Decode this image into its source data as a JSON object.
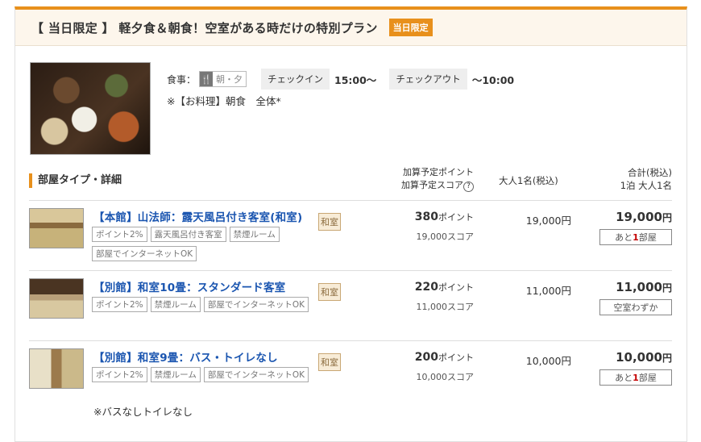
{
  "plan": {
    "title": "【 当日限定 】 軽夕食＆朝食！空室がある時だけの特別プラン",
    "badge": "当日限定",
    "meal_label": "食事：",
    "meal_value": "朝・夕",
    "checkin_label": "チェックイン",
    "checkin_time": "15:00〜",
    "checkout_label": "チェックアウト",
    "checkout_time": "〜10:00",
    "note": "※【お料理】朝食　全体*"
  },
  "table": {
    "room_type_header": "部屋タイプ・詳細",
    "points_header_1": "加算予定ポイント",
    "points_header_2": "加算予定スコア",
    "price_header": "大人1名(税込)",
    "total_header": "合計(税込)",
    "total_sub": "1泊 大人1名"
  },
  "rooms": [
    {
      "name": "【本館】山法師：露天風呂付き客室(和室)",
      "tags": [
        "ポイント2%",
        "露天風呂付き客室",
        "禁煙ルーム",
        "部屋でインターネットOK"
      ],
      "type": "和室",
      "points": "380",
      "points_unit": "ポイント",
      "score": "19,000スコア",
      "adult_price": "19,000円",
      "total": "19,000",
      "total_unit": "円",
      "avail_pre": "あと",
      "avail_num": "1",
      "avail_post": "部屋"
    },
    {
      "name": "【別館】和室10畳：スタンダード客室",
      "tags": [
        "ポイント2%",
        "禁煙ルーム",
        "部屋でインターネットOK"
      ],
      "type": "和室",
      "points": "220",
      "points_unit": "ポイント",
      "score": "11,000スコア",
      "adult_price": "11,000円",
      "total": "11,000",
      "total_unit": "円",
      "avail_text": "空室わずか"
    },
    {
      "name": "【別館】和室9畳：バス・トイレなし",
      "tags": [
        "ポイント2%",
        "禁煙ルーム",
        "部屋でインターネットOK"
      ],
      "type": "和室",
      "points": "200",
      "points_unit": "ポイント",
      "score": "10,000スコア",
      "adult_price": "10,000円",
      "total": "10,000",
      "total_unit": "円",
      "avail_pre": "あと",
      "avail_num": "1",
      "avail_post": "部屋",
      "note": "※バスなしトイレなし"
    }
  ],
  "colors": {
    "accent": "#e8901c",
    "link": "#1a55b0",
    "alert": "#c40000"
  }
}
